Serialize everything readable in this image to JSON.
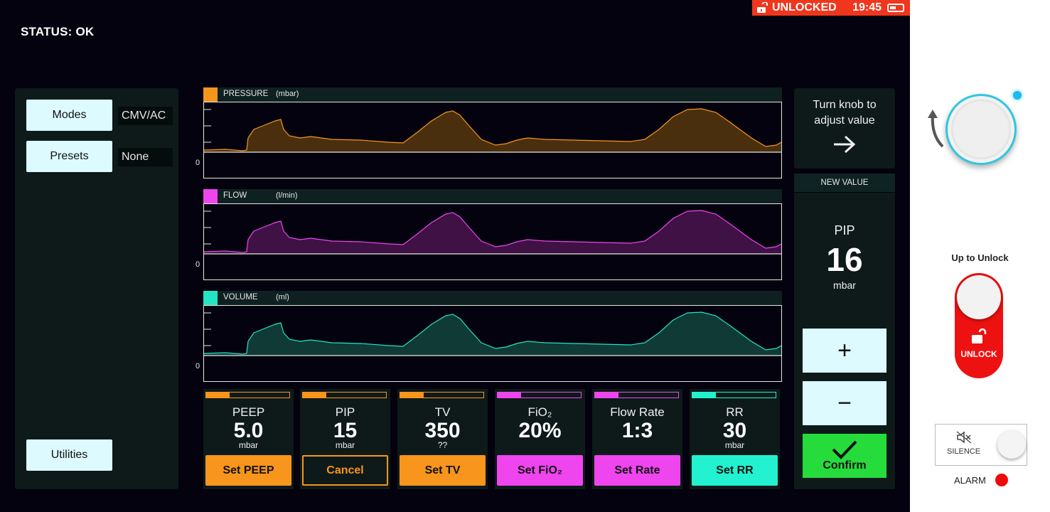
{
  "topbar": {
    "lock_status": "UNLOCKED",
    "time": "19:45"
  },
  "status": "STATUS: OK",
  "left_panel": {
    "modes_label": "Modes",
    "modes_value": "CMV/AC",
    "presets_label": "Presets",
    "presets_value": "None",
    "utilities_label": "Utilities"
  },
  "graphs": [
    {
      "name": "PRESSURE",
      "unit": "(mbar)",
      "zero": "0",
      "color": "#f7951d"
    },
    {
      "name": "FLOW",
      "unit": "(l/min)",
      "zero": "0",
      "color": "#ee45ee"
    },
    {
      "name": "VOLUME",
      "unit": "(ml)",
      "zero": "0",
      "color": "#22e5c4"
    }
  ],
  "cards": [
    {
      "label": "PEEP",
      "value": "5.0",
      "unit": "mbar",
      "button": "Set PEEP",
      "color": "#f7951d",
      "level": 0.28
    },
    {
      "label": "PIP",
      "value": "15",
      "unit": "mbar",
      "button": "Cancel",
      "color": "#f7951d",
      "level": 0.28
    },
    {
      "label": "TV",
      "value": "350",
      "unit": "??",
      "button": "Set TV",
      "color": "#f7951d",
      "level": 0.28
    },
    {
      "label": "FiO₂",
      "value": "20%",
      "unit": "",
      "button": "Set FiO₂",
      "color": "#ee45ee",
      "level": 0.28
    },
    {
      "label": "Flow Rate",
      "value": "1:3",
      "unit": "",
      "button": "Set Rate",
      "color": "#ee45ee",
      "level": 0.28
    },
    {
      "label": "RR",
      "value": "30",
      "unit": "mbar",
      "button": "Set RR",
      "color": "#22f2d0",
      "level": 0.28
    }
  ],
  "turn_knob": {
    "line1": "Turn knob to",
    "line2": "adjust value"
  },
  "new_value": {
    "header": "NEW VALUE",
    "label": "PIP",
    "value": "16",
    "unit": "mbar",
    "plus": "+",
    "minus": "−",
    "confirm": "Confirm"
  },
  "side_panel": {
    "up_to_unlock": "Up to Unlock",
    "unlock": "UNLOCK",
    "silence": "SILENCE",
    "alarm": "ALARM"
  }
}
